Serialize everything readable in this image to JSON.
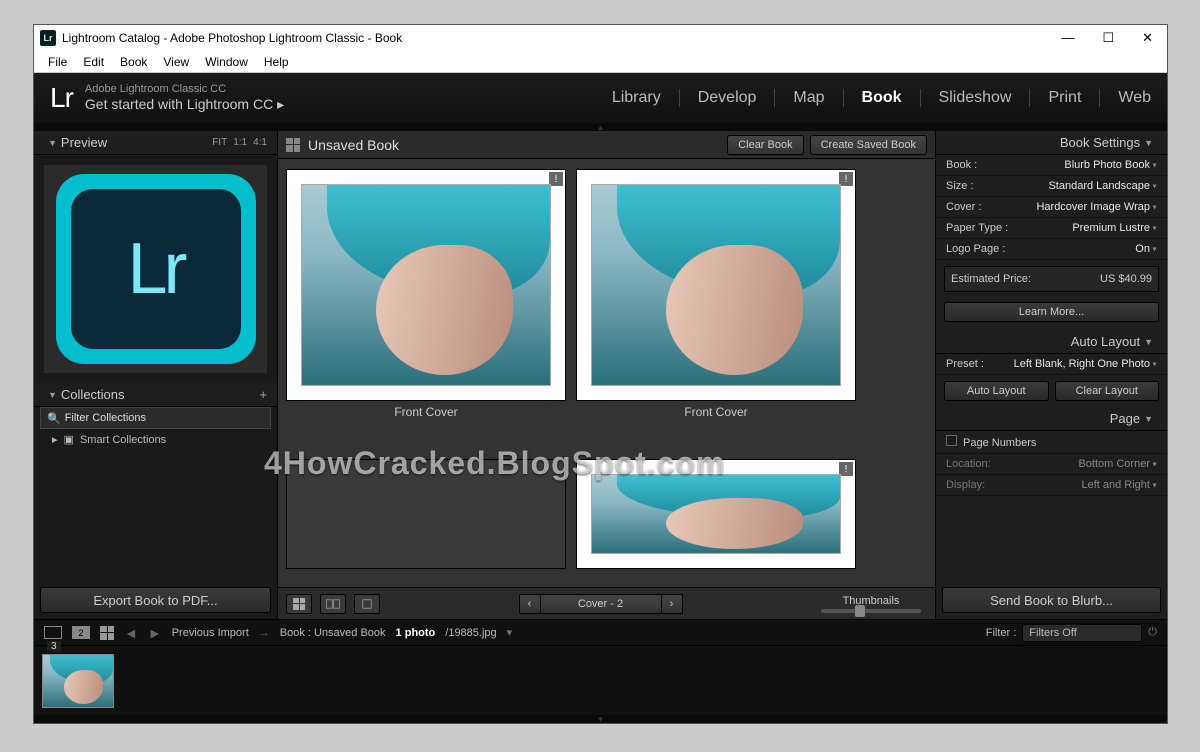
{
  "window": {
    "title": "Lightroom Catalog - Adobe Photoshop Lightroom Classic - Book"
  },
  "menu": {
    "items": [
      "File",
      "Edit",
      "Book",
      "View",
      "Window",
      "Help"
    ]
  },
  "brand": {
    "logo": "Lr",
    "line1": "Adobe Lightroom Classic CC",
    "line2": "Get started with Lightroom CC ▸"
  },
  "modules": {
    "items": [
      "Library",
      "Develop",
      "Map",
      "Book",
      "Slideshow",
      "Print",
      "Web"
    ],
    "active": "Book"
  },
  "left": {
    "preview": {
      "title": "Preview",
      "zoom": [
        "FIT",
        "1:1",
        "4:1"
      ]
    },
    "collections": {
      "title": "Collections",
      "filter_placeholder": "Filter Collections",
      "smart": "Smart Collections"
    },
    "export_btn": "Export Book to PDF..."
  },
  "mid": {
    "header": {
      "title": "Unsaved Book",
      "clear": "Clear Book",
      "save": "Create Saved Book"
    },
    "thumbs": {
      "cap1": "Front Cover",
      "cap2": "Front Cover"
    },
    "footer": {
      "pager": "Cover - 2",
      "thumbs_label": "Thumbnails"
    }
  },
  "right": {
    "book_settings": {
      "title": "Book Settings",
      "book_label": "Book :",
      "book_val": "Blurb Photo Book",
      "size_label": "Size :",
      "size_val": "Standard Landscape",
      "cover_label": "Cover :",
      "cover_val": "Hardcover Image Wrap",
      "paper_label": "Paper Type :",
      "paper_val": "Premium Lustre",
      "logo_label": "Logo Page :",
      "logo_val": "On",
      "price_label": "Estimated Price:",
      "price_val": "US $40.99",
      "learn": "Learn More..."
    },
    "auto_layout": {
      "title": "Auto Layout",
      "preset_label": "Preset :",
      "preset_val": "Left Blank, Right One Photo",
      "auto_btn": "Auto Layout",
      "clear_btn": "Clear Layout"
    },
    "page": {
      "title": "Page",
      "pagenum_label": "Page Numbers",
      "loc_label": "Location:",
      "loc_val": "Bottom Corner",
      "disp_label": "Display:",
      "disp_val": "Left and Right"
    },
    "send_btn": "Send Book to Blurb..."
  },
  "status": {
    "second_num": "2",
    "prev_import": "Previous Import",
    "book_crumb": "Book : Unsaved Book",
    "photo_count": "1 photo",
    "filename": "/19885.jpg",
    "filter_label": "Filter :",
    "filter_val": "Filters Off"
  },
  "filmstrip": {
    "thumb_num": "3"
  },
  "watermark": "4HowCracked.BlogSpot.com"
}
